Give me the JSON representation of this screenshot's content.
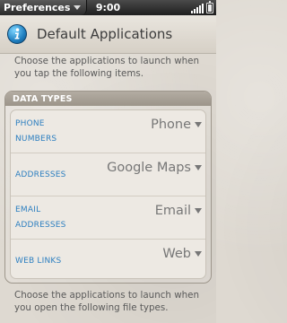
{
  "statusbar": {
    "app_menu": "Preferences",
    "clock": "9:00"
  },
  "header": {
    "title": "Default Applications",
    "icon": "info-icon"
  },
  "description_top": "Choose the applications to launch when you tap the following items.",
  "data_types": {
    "heading": "DATA TYPES",
    "rows": [
      {
        "label_line1": "PHONE",
        "label_line2": "NUMBERS",
        "value": "Phone"
      },
      {
        "label_line1": "ADDRESSES",
        "label_line2": "",
        "value": "Google Maps"
      },
      {
        "label_line1": "EMAIL",
        "label_line2": "ADDRESSES",
        "value": "Email"
      },
      {
        "label_line1": "WEB LINKS",
        "label_line2": "",
        "value": "Web"
      }
    ]
  },
  "description_bottom": "Choose the applications to launch when you open the following file types.",
  "colors": {
    "label_blue": "#2d7fc0",
    "header_bar": "#a59e93",
    "background": "#ded9d1"
  }
}
